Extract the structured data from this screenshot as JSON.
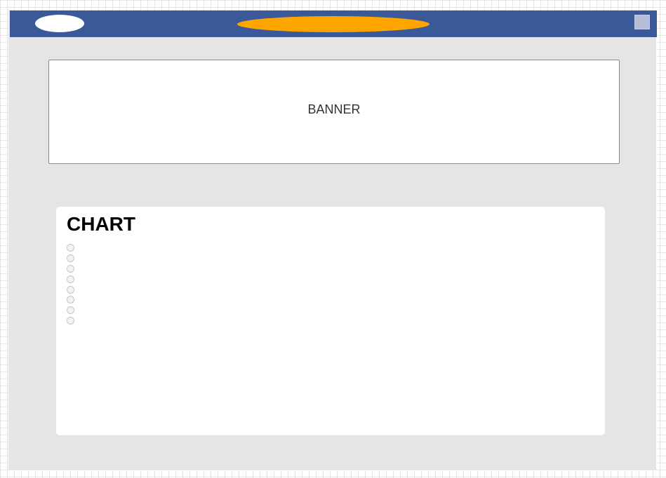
{
  "header": {
    "colors": {
      "bar": "#3b5998",
      "logo": "#ffffff",
      "pill": "#ffa500",
      "square": "#b6bdd9"
    }
  },
  "banner": {
    "label": "BANNER"
  },
  "chart": {
    "title": "CHART",
    "radio_count": 8
  }
}
